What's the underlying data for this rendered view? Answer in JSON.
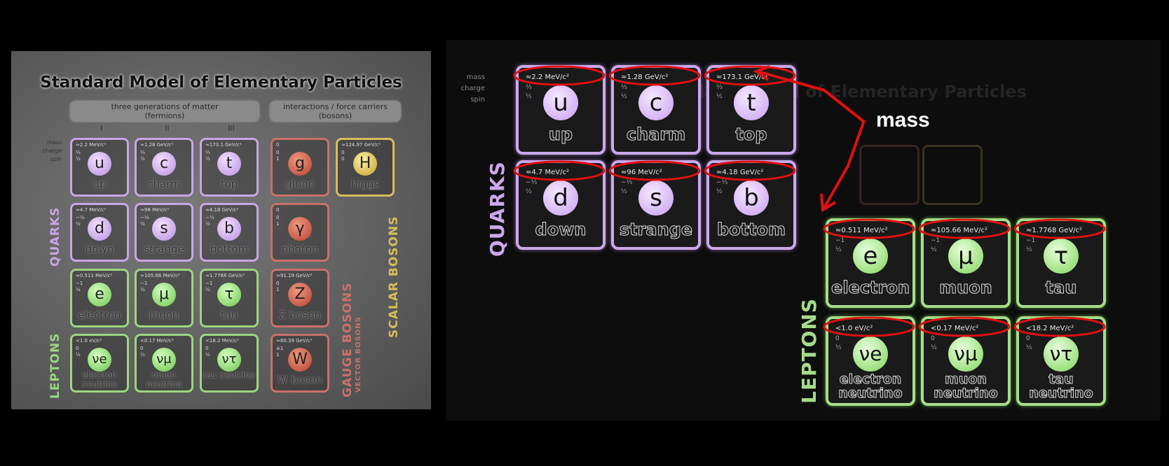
{
  "left": {
    "title": "Standard Model of Elementary Particles",
    "fermions_header": "three generations of matter\n(fermions)",
    "bosons_header": "interactions / force carriers\n(bosons)",
    "generations": [
      "I",
      "II",
      "III"
    ],
    "row_labels": [
      "mass",
      "charge",
      "spin"
    ],
    "quarks_label": "QUARKS",
    "leptons_label": "LEPTONS",
    "gauge_label": "GAUGE BOSONS",
    "vector_label": "VECTOR BOSONS",
    "scalar_label": "SCALAR BOSONS",
    "cells": [
      {
        "sym": "u",
        "name": "up",
        "mass": "≈2.2 MeV/c²",
        "charge": "⅔",
        "spin": "½"
      },
      {
        "sym": "c",
        "name": "charm",
        "mass": "≈1.28 GeV/c²",
        "charge": "⅔",
        "spin": "½"
      },
      {
        "sym": "t",
        "name": "top",
        "mass": "≈173.1 GeV/c²",
        "charge": "⅔",
        "spin": "½"
      },
      {
        "sym": "g",
        "name": "gluon",
        "mass": "0",
        "charge": "0",
        "spin": "1"
      },
      {
        "sym": "H",
        "name": "higgs",
        "mass": "≈124.97 GeV/c²",
        "charge": "0",
        "spin": "0"
      },
      {
        "sym": "d",
        "name": "down",
        "mass": "≈4.7 MeV/c²",
        "charge": "−⅓",
        "spin": "½"
      },
      {
        "sym": "s",
        "name": "strange",
        "mass": "≈96 MeV/c²",
        "charge": "−⅓",
        "spin": "½"
      },
      {
        "sym": "b",
        "name": "bottom",
        "mass": "≈4.18 GeV/c²",
        "charge": "−⅓",
        "spin": "½"
      },
      {
        "sym": "γ",
        "name": "photon",
        "mass": "0",
        "charge": "0",
        "spin": "1"
      },
      {
        "sym": "e",
        "name": "electron",
        "mass": "≈0.511 MeV/c²",
        "charge": "−1",
        "spin": "½"
      },
      {
        "sym": "μ",
        "name": "muon",
        "mass": "≈105.66 MeV/c²",
        "charge": "−1",
        "spin": "½"
      },
      {
        "sym": "τ",
        "name": "tau",
        "mass": "≈1.7768 GeV/c²",
        "charge": "−1",
        "spin": "½"
      },
      {
        "sym": "Z",
        "name": "Z boson",
        "mass": "≈91.19 GeV/c²",
        "charge": "0",
        "spin": "1"
      },
      {
        "sym": "νe",
        "name": "electron neutrino",
        "mass": "<1.0 eV/c²",
        "charge": "0",
        "spin": "½"
      },
      {
        "sym": "νμ",
        "name": "muon neutrino",
        "mass": "<0.17 MeV/c²",
        "charge": "0",
        "spin": "½"
      },
      {
        "sym": "ντ",
        "name": "tau neutrino",
        "mass": "<18.2 MeV/c²",
        "charge": "0",
        "spin": "½"
      },
      {
        "sym": "W",
        "name": "W boson",
        "mass": "≈80.39 GeV/c²",
        "charge": "±1",
        "spin": "1"
      }
    ]
  },
  "right": {
    "row_labels": [
      "mass",
      "charge",
      "spin"
    ],
    "quarks_label": "QUARKS",
    "leptons_label": "LEPTONS",
    "annotation": "mass",
    "annotation_color": "#e01010",
    "ghost_title": "Standard Model of Elementary Particles",
    "quarks": [
      {
        "sym": "u",
        "name": "up",
        "mass": "≈2.2 MeV/c²",
        "charge": "⅔",
        "spin": "½"
      },
      {
        "sym": "c",
        "name": "charm",
        "mass": "≈1.28 GeV/c²",
        "charge": "⅔",
        "spin": "½"
      },
      {
        "sym": "t",
        "name": "top",
        "mass": "≈173.1 GeV/c²",
        "charge": "⅔",
        "spin": "½"
      },
      {
        "sym": "d",
        "name": "down",
        "mass": "≈4.7 MeV/c²",
        "charge": "−⅓",
        "spin": "½"
      },
      {
        "sym": "s",
        "name": "strange",
        "mass": "≈96 MeV/c²",
        "charge": "−⅓",
        "spin": "½"
      },
      {
        "sym": "b",
        "name": "bottom",
        "mass": "≈4.18 GeV/c²",
        "charge": "−⅓",
        "spin": "½"
      }
    ],
    "leptons": [
      {
        "sym": "e",
        "name": "electron",
        "mass": "≈0.511 MeV/c²",
        "charge": "−1",
        "spin": "½"
      },
      {
        "sym": "μ",
        "name": "muon",
        "mass": "≈105.66 MeV/c²",
        "charge": "−1",
        "spin": "½"
      },
      {
        "sym": "τ",
        "name": "tau",
        "mass": "≈1.7768 GeV/c²",
        "charge": "−1",
        "spin": "½"
      },
      {
        "sym": "νe",
        "name": "electron neutrino",
        "mass": "<1.0 eV/c²",
        "charge": "0",
        "spin": "½"
      },
      {
        "sym": "νμ",
        "name": "muon neutrino",
        "mass": "<0.17 MeV/c²",
        "charge": "0",
        "spin": "½"
      },
      {
        "sym": "ντ",
        "name": "tau neutrino",
        "mass": "<18.2 MeV/c²",
        "charge": "0",
        "spin": "½"
      }
    ]
  }
}
